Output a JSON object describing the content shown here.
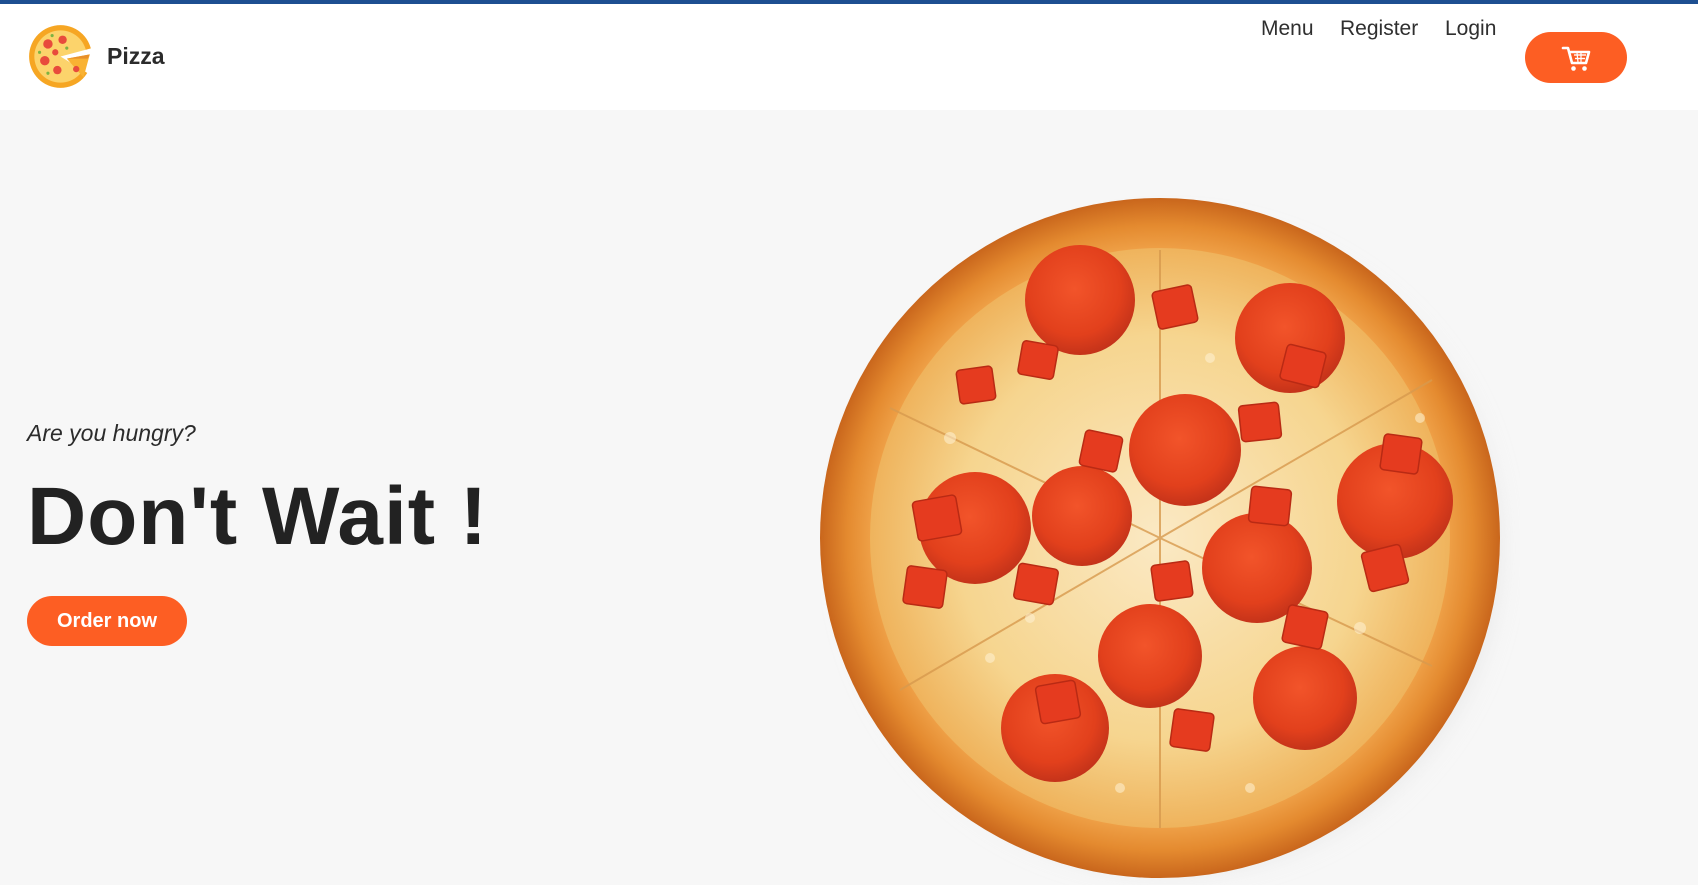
{
  "brand": {
    "name": "Pizza",
    "logo_icon": "pizza-slice-icon"
  },
  "nav": {
    "items": [
      {
        "label": "Menu"
      },
      {
        "label": "Register"
      },
      {
        "label": "Login"
      }
    ],
    "cart_icon": "shopping-cart-icon"
  },
  "hero": {
    "tagline": "Are you hungry?",
    "headline": "Don't Wait !",
    "cta_label": "Order now",
    "image": "pepperoni-pizza-image"
  },
  "colors": {
    "accent": "#fd5e23",
    "top_strip": "#1d4f91",
    "header_bg": "#ffffff",
    "page_bg": "#f7f7f7",
    "text": "#222222"
  }
}
